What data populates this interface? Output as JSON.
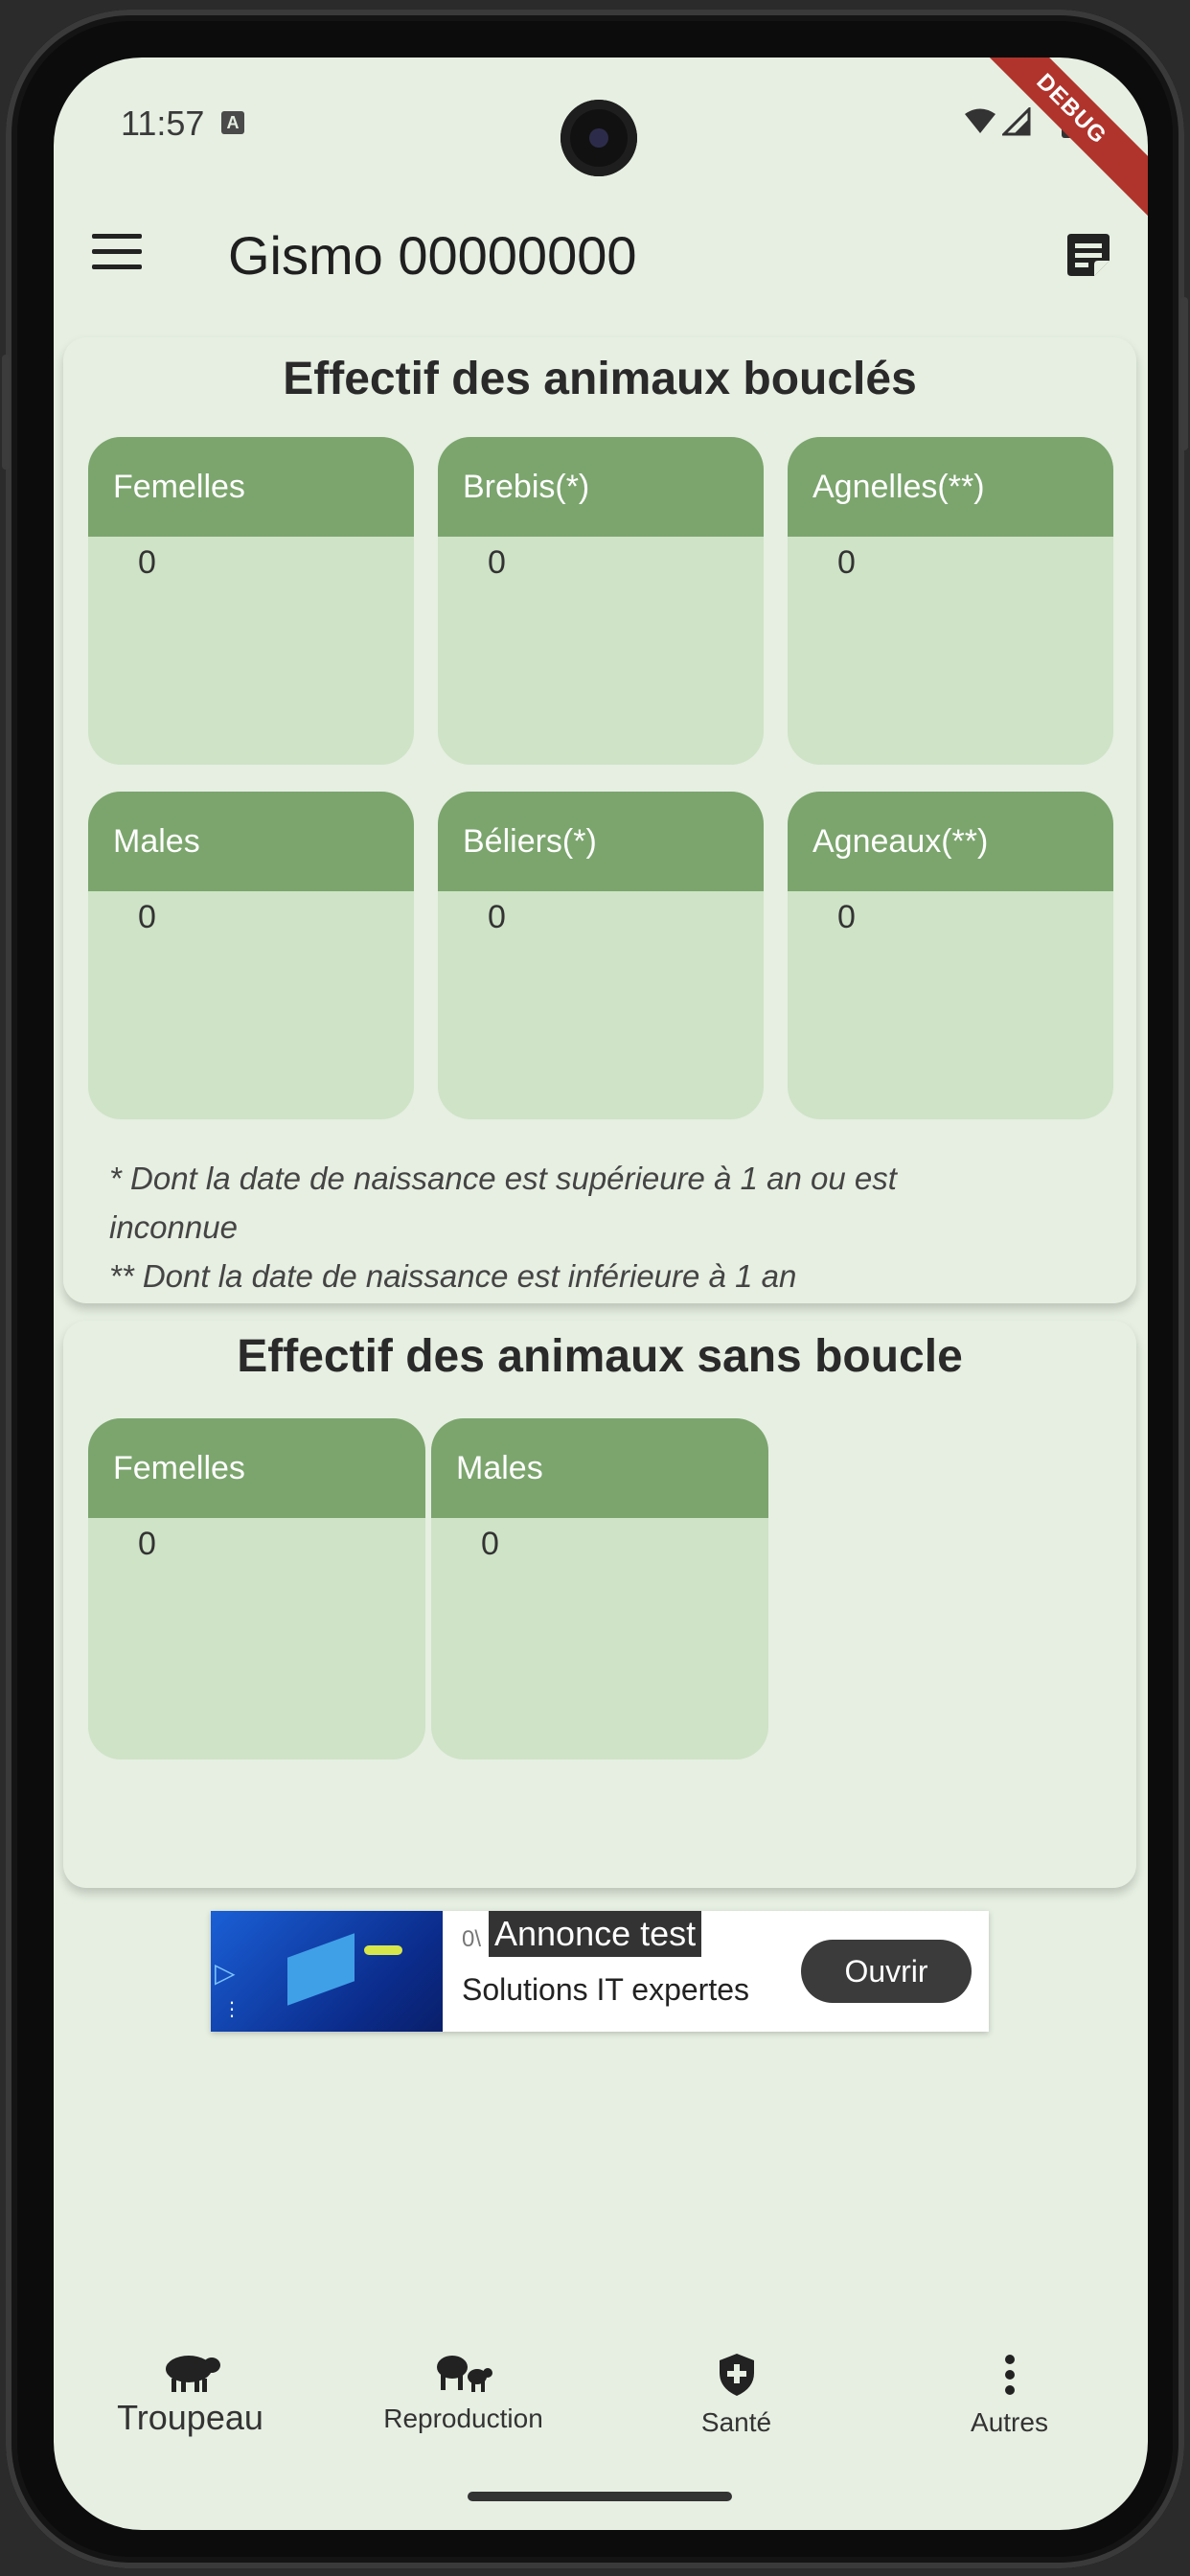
{
  "status_bar": {
    "time": "11:57",
    "notification_badge": "A",
    "debug_banner": "DEBUG"
  },
  "app_bar": {
    "title": "Gismo 00000000"
  },
  "tagged_section": {
    "title": "Effectif des animaux bouclés",
    "tiles": [
      {
        "label": "Femelles",
        "value": "0"
      },
      {
        "label": "Brebis(*)",
        "value": "0"
      },
      {
        "label": "Agnelles(**)",
        "value": "0"
      },
      {
        "label": "Males",
        "value": "0"
      },
      {
        "label": "Béliers(*)",
        "value": "0"
      },
      {
        "label": "Agneaux(**)",
        "value": "0"
      }
    ],
    "note_line1": "* Dont la date de naissance est supérieure à 1 an ou est",
    "note_line2": "inconnue",
    "note_line3": "** Dont la date de naissance est inférieure à 1 an"
  },
  "untagged_section": {
    "title": "Effectif des animaux sans boucle",
    "tiles": [
      {
        "label": "Femelles",
        "value": "0"
      },
      {
        "label": "Males",
        "value": "0"
      }
    ]
  },
  "ad": {
    "label": "Annonce test",
    "partial_text": "0\\",
    "text": "Solutions IT expertes",
    "button": "Ouvrir"
  },
  "bottom_nav": {
    "items": [
      {
        "label": "Troupeau",
        "icon": "sheep-icon"
      },
      {
        "label": "Reproduction",
        "icon": "sheep-family-icon"
      },
      {
        "label": "Santé",
        "icon": "shield-plus-icon"
      },
      {
        "label": "Autres",
        "icon": "more-vertical-icon"
      }
    ]
  },
  "colors": {
    "background": "#e6efe2",
    "tile_header": "#7ba56d",
    "tile_body": "#cfe3c7",
    "debug": "#b0342c"
  }
}
